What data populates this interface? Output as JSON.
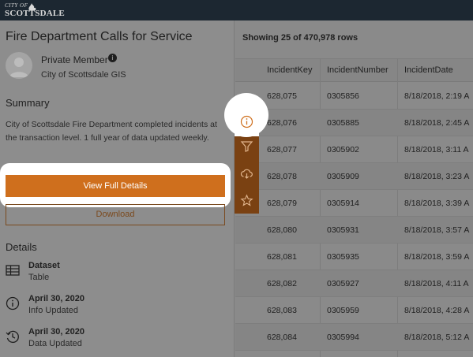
{
  "header": {
    "logo_small": "CITY OF",
    "logo_big": "SCOTTSDALE"
  },
  "panel": {
    "title": "Fire Department Calls for Service",
    "owner": {
      "name": "Private Member",
      "info_icon": "i",
      "org": "City of Scottsdale GIS"
    },
    "summary_heading": "Summary",
    "summary_text": "City of Scottsdale Fire Department completed incidents at the transaction level. 1 full year of data updated weekly.",
    "view_button": "View Full Details",
    "download_button": "Download",
    "details_heading": "Details",
    "details": [
      {
        "icon": "table-icon",
        "main": "Dataset",
        "sub": "Table"
      },
      {
        "icon": "info-icon",
        "main": "April 30, 2020",
        "sub": "Info Updated"
      },
      {
        "icon": "history-icon",
        "main": "April 30, 2020",
        "sub": "Data Updated"
      }
    ]
  },
  "toolstrip": {
    "items": [
      "info-icon",
      "filter-icon",
      "download-cloud-icon",
      "star-icon"
    ],
    "accent": "#cf6f1d"
  },
  "table": {
    "showing": "Showing 25 of 470,978 rows",
    "columns": [
      "IncidentKey",
      "IncidentNumber",
      "IncidentDate"
    ],
    "rows": [
      [
        "628,075",
        "0305856",
        "8/18/2018, 2:19 A"
      ],
      [
        "628,076",
        "0305885",
        "8/18/2018, 2:45 A"
      ],
      [
        "628,077",
        "0305902",
        "8/18/2018, 3:11 A"
      ],
      [
        "628,078",
        "0305909",
        "8/18/2018, 3:23 A"
      ],
      [
        "628,079",
        "0305914",
        "8/18/2018, 3:39 A"
      ],
      [
        "628,080",
        "0305931",
        "8/18/2018, 3:57 A"
      ],
      [
        "628,081",
        "0305935",
        "8/18/2018, 3:59 A"
      ],
      [
        "628,082",
        "0305927",
        "8/18/2018, 4:11 A"
      ],
      [
        "628,083",
        "0305959",
        "8/18/2018, 4:28 A"
      ],
      [
        "628,084",
        "0305994",
        "8/18/2018, 5:12 A"
      ]
    ]
  },
  "colors": {
    "brand_orange": "#cf6f1d",
    "topbar": "#1c2731",
    "overlay_gray": "#8a8a8a"
  }
}
